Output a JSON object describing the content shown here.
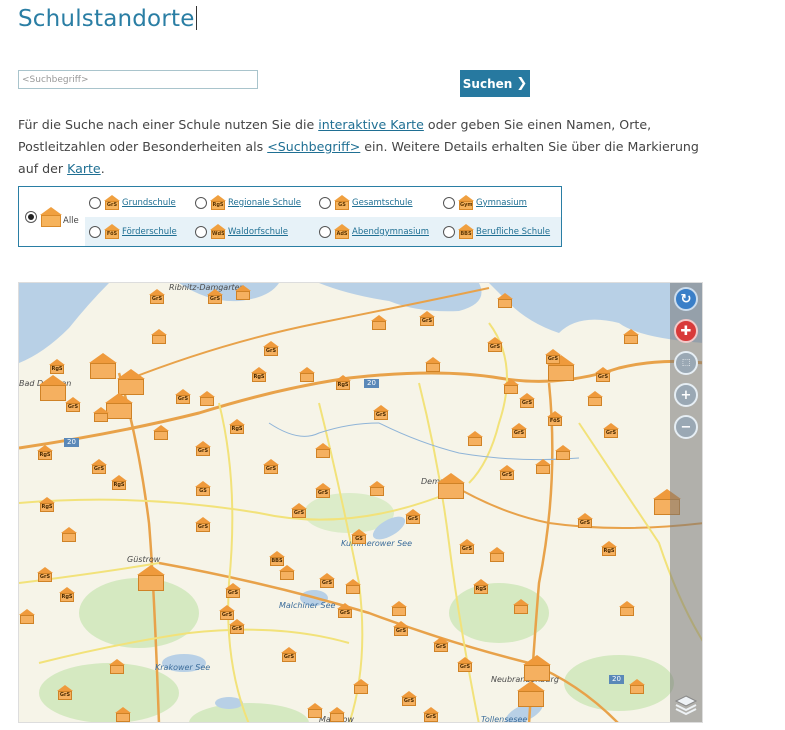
{
  "page": {
    "title": "Schulstandorte"
  },
  "search": {
    "placeholder": "<Suchbegriff>",
    "value": "",
    "button_label": "Suchen",
    "button_icon": "chevron-right-icon"
  },
  "intro": {
    "t1": "Für die Suche nach einer Schule nutzen Sie die ",
    "link_map": "interaktive Karte",
    "t2": " oder geben Sie einen Namen, Orte, Postleitzahlen oder Besonderheiten als ",
    "link_search": "<Suchbegriff>",
    "t3": " ein. Weitere Details erhalten Sie über die Markierung auf der ",
    "link_karte": "Karte",
    "t4": "."
  },
  "filter": {
    "all_label": "Alle",
    "selected": "all",
    "options": [
      {
        "abbr": "GrS",
        "label": "Grundschule"
      },
      {
        "abbr": "RgS",
        "label": "Regionale Schule"
      },
      {
        "abbr": "GS",
        "label": "Gesamtschule"
      },
      {
        "abbr": "Gym",
        "label": "Gymnasium"
      },
      {
        "abbr": "FöS",
        "label": "Förderschule"
      },
      {
        "abbr": "WdS",
        "label": "Waldorfschule"
      },
      {
        "abbr": "AdS",
        "label": "Abendgymnasium"
      },
      {
        "abbr": "BBS",
        "label": "Berufliche Schule"
      }
    ]
  },
  "map": {
    "places": {
      "ribnitz": "Ribnitz-Damgarten",
      "bad_doberan": "Bad Doberan",
      "guestrow": "Güstrow",
      "demmin": "Demmin",
      "neubrandenburg": "Neubrandenburg",
      "krakower": "Krakower See",
      "kummerower": "Kummerower See",
      "malchiner": "Malchiner See",
      "tollensesee": "Tollensesee",
      "malchow": "Malchow"
    },
    "road_labels": {
      "a20": "20"
    },
    "colors": {
      "land": "#f6f4e8",
      "water": "#b8d0e6",
      "forest": "#cfe6b8",
      "road_major": "#e8a24a",
      "road_minor": "#f2e27a"
    },
    "controls": {
      "refresh": "refresh-icon",
      "pan": "pan-icon",
      "zoom_box": "zoom-box-icon",
      "zoom_in": "zoom-in-icon",
      "zoom_out": "zoom-out-icon",
      "layers": "layers-icon"
    }
  }
}
